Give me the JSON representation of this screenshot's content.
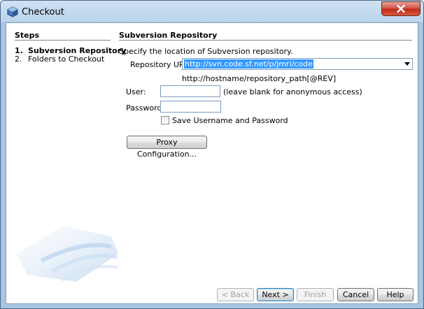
{
  "window": {
    "title": "Checkout",
    "close_icon": "close-icon"
  },
  "steps": {
    "heading": "Steps",
    "items": [
      {
        "num": "1.",
        "label": "Subversion Repository",
        "active": true
      },
      {
        "num": "2.",
        "label": "Folders to Checkout",
        "active": false
      }
    ]
  },
  "panel": {
    "heading": "Subversion Repository",
    "description": "Specify the location of Subversion repository.",
    "repository_url": {
      "label": "Repository URL:",
      "value": "http://svn.code.sf.net/p/jmri/code",
      "hint": "http://hostname/repository_path[@REV]"
    },
    "user": {
      "label": "User:",
      "value": "",
      "note": "(leave blank for anonymous access)"
    },
    "password": {
      "label": "Password:",
      "value": ""
    },
    "save_credentials": {
      "label": "Save Username and Password",
      "checked": false
    },
    "proxy_button": "Proxy Configuration..."
  },
  "footer": {
    "back": "< Back",
    "next": "Next >",
    "finish": "Finish",
    "cancel": "Cancel",
    "help": "Help"
  }
}
